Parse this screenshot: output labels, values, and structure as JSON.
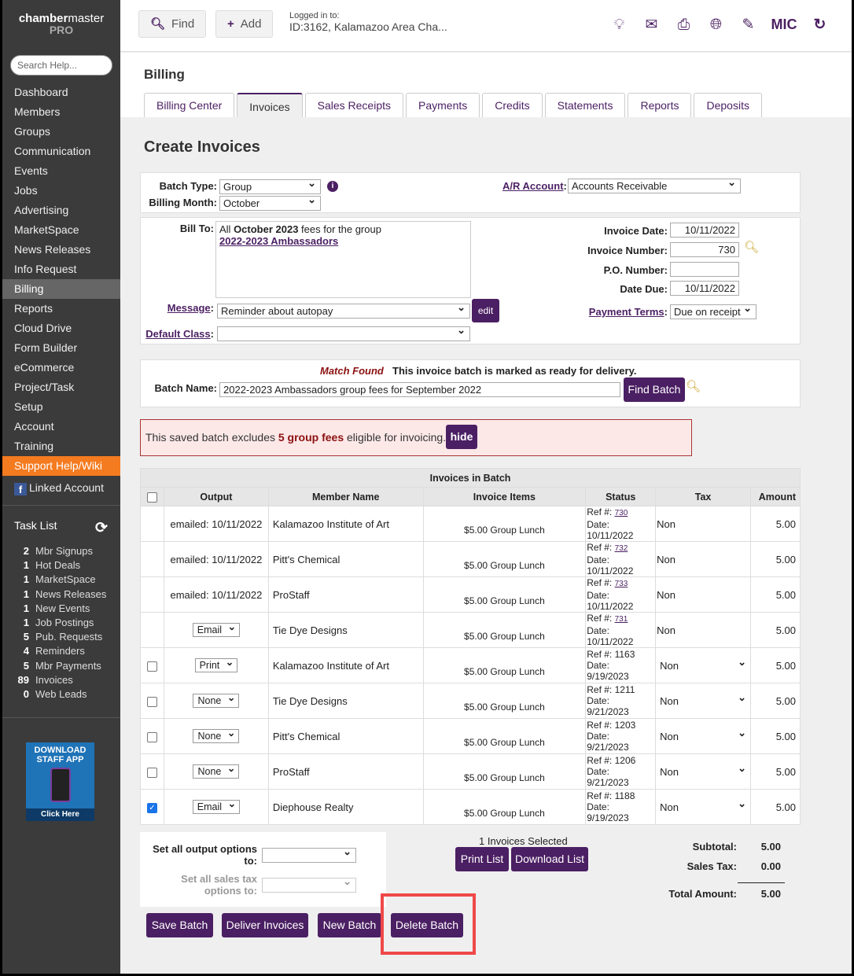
{
  "app": {
    "brand_bold": "chamber",
    "brand_rest": "master",
    "edition": "PRO"
  },
  "sidebar": {
    "search_placeholder": "Search Help...",
    "items": [
      "Dashboard",
      "Members",
      "Groups",
      "Communication",
      "Events",
      "Jobs",
      "Advertising",
      "MarketSpace",
      "News Releases",
      "Info Request",
      "Billing",
      "Reports",
      "Cloud Drive",
      "Form Builder",
      "eCommerce",
      "Project/Task",
      "Setup",
      "Account",
      "Training",
      "Support Help/Wiki"
    ],
    "active": "Billing",
    "linked_account": "Linked Account",
    "task_list_title": "Task List",
    "tasks": [
      {
        "count": "2",
        "label": "Mbr Signups"
      },
      {
        "count": "1",
        "label": "Hot Deals"
      },
      {
        "count": "1",
        "label": "MarketSpace"
      },
      {
        "count": "1",
        "label": "News Releases"
      },
      {
        "count": "1",
        "label": "New Events"
      },
      {
        "count": "1",
        "label": "Job Postings"
      },
      {
        "count": "5",
        "label": "Pub. Requests"
      },
      {
        "count": "4",
        "label": "Reminders"
      },
      {
        "count": "5",
        "label": "Mbr Payments"
      },
      {
        "count": "89",
        "label": "Invoices"
      },
      {
        "count": "0",
        "label": "Web Leads"
      }
    ],
    "app_banner": {
      "line1": "DOWNLOAD",
      "line2": "STAFF APP",
      "cta": "Click Here"
    }
  },
  "header": {
    "find": "Find",
    "add": "Add",
    "logged_label": "Logged in to:",
    "logged_value": "ID:3162, Kalamazoo Area Cha...",
    "user_initials": "MIC"
  },
  "billing": {
    "title": "Billing",
    "tabs": [
      "Billing Center",
      "Invoices",
      "Sales Receipts",
      "Payments",
      "Credits",
      "Statements",
      "Reports",
      "Deposits"
    ],
    "active_tab": "Invoices"
  },
  "form": {
    "page_title": "Create Invoices",
    "batch_type_label": "Batch Type:",
    "batch_type": "Group",
    "billing_month_label": "Billing Month:",
    "billing_month": "October",
    "ar_account_label": "A/R Account",
    "ar_account": "Accounts Receivable",
    "bill_to_label": "Bill To:",
    "bill_to_prefix": "All ",
    "bill_to_bold": "October 2023",
    "bill_to_suffix": " fees for the group",
    "bill_to_group": "2022-2023 Ambassadors",
    "message_label": "Message",
    "message": "Reminder about autopay",
    "edit": "edit",
    "default_class_label": "Default Class",
    "default_class": "",
    "invoice_date_label": "Invoice Date:",
    "invoice_date": "10/11/2022",
    "invoice_number_label": "Invoice Number:",
    "invoice_number": "730",
    "po_label": "P.O. Number:",
    "po": "",
    "date_due_label": "Date Due:",
    "date_due": "10/11/2022",
    "payment_terms_label": "Payment Terms",
    "payment_terms": "Due on receipt",
    "match_found": "Match Found",
    "match_msg": "This invoice batch is marked as ready for delivery.",
    "batch_name_label": "Batch Name:",
    "batch_name": "2022-2023 Ambassadors group fees for September 2022",
    "find_batch": "Find Batch",
    "warn_prefix": "This saved batch excludes ",
    "warn_bold": "5 group fees",
    "warn_suffix": " eligible for invoicing.",
    "hide": "hide"
  },
  "table": {
    "title": "Invoices in Batch",
    "columns": [
      "Output",
      "Member Name",
      "Invoice Items",
      "Status",
      "Tax",
      "Amount"
    ],
    "rows": [
      {
        "check": null,
        "output": "emailed: 10/11/2022",
        "output_select": false,
        "member": "Kalamazoo Institute of Art",
        "item": "$5.00 Group Lunch",
        "ref": "730",
        "ref_link": true,
        "date": "10/11/2022",
        "tax": "Non",
        "tax_select": false,
        "amount": "5.00"
      },
      {
        "check": null,
        "output": "emailed: 10/11/2022",
        "output_select": false,
        "member": "Pitt's Chemical",
        "item": "$5.00 Group Lunch",
        "ref": "732",
        "ref_link": true,
        "date": "10/11/2022",
        "tax": "Non",
        "tax_select": false,
        "amount": "5.00"
      },
      {
        "check": null,
        "output": "emailed: 10/11/2022",
        "output_select": false,
        "member": "ProStaff",
        "item": "$5.00 Group Lunch",
        "ref": "733",
        "ref_link": true,
        "date": "10/11/2022",
        "tax": "Non",
        "tax_select": false,
        "amount": "5.00"
      },
      {
        "check": null,
        "output": "Email",
        "output_select": true,
        "member": "Tie Dye Designs",
        "item": "$5.00 Group Lunch",
        "ref": "731",
        "ref_link": true,
        "date": "10/11/2022",
        "tax": "Non",
        "tax_select": false,
        "amount": "5.00"
      },
      {
        "check": false,
        "output": "Print",
        "output_select": true,
        "member": "Kalamazoo Institute of Art",
        "item": "$5.00 Group Lunch",
        "ref": "1163",
        "ref_link": false,
        "date": "9/19/2023",
        "tax": "Non",
        "tax_select": true,
        "amount": "5.00"
      },
      {
        "check": false,
        "output": "None",
        "output_select": true,
        "member": "Tie Dye Designs",
        "item": "$5.00 Group Lunch",
        "ref": "1211",
        "ref_link": false,
        "date": "9/21/2023",
        "tax": "Non",
        "tax_select": true,
        "amount": "5.00"
      },
      {
        "check": false,
        "output": "None",
        "output_select": true,
        "member": "Pitt's Chemical",
        "item": "$5.00 Group Lunch",
        "ref": "1203",
        "ref_link": false,
        "date": "9/21/2023",
        "tax": "Non",
        "tax_select": true,
        "amount": "5.00"
      },
      {
        "check": false,
        "output": "None",
        "output_select": true,
        "member": "ProStaff",
        "item": "$5.00 Group Lunch",
        "ref": "1206",
        "ref_link": false,
        "date": "9/21/2023",
        "tax": "Non",
        "tax_select": true,
        "amount": "5.00"
      },
      {
        "check": true,
        "output": "Email",
        "output_select": true,
        "member": "Diephouse Realty",
        "item": "$5.00 Group Lunch",
        "ref": "1188",
        "ref_link": false,
        "date": "9/19/2023",
        "tax": "Non",
        "tax_select": true,
        "amount": "5.00"
      }
    ],
    "ref_label": "Ref #:",
    "date_label": "Date:"
  },
  "footer": {
    "set_output_label": "Set all output options to:",
    "set_tax_label": "Set all sales tax options to:",
    "selected_count": "1",
    "selected_text": " Invoices Selected",
    "print_list": "Print List",
    "download_list": "Download List",
    "subtotal_label": "Subtotal:",
    "subtotal": "5.00",
    "sales_tax_label": "Sales Tax:",
    "sales_tax": "0.00",
    "total_label": "Total Amount:",
    "total": "5.00",
    "save_batch": "Save Batch",
    "deliver_invoices": "Deliver Invoices",
    "new_batch": "New Batch",
    "delete_batch": "Delete Batch"
  },
  "colors": {
    "brand": "#4b1f63",
    "highlight": "#f04848",
    "support": "#f47b20"
  }
}
